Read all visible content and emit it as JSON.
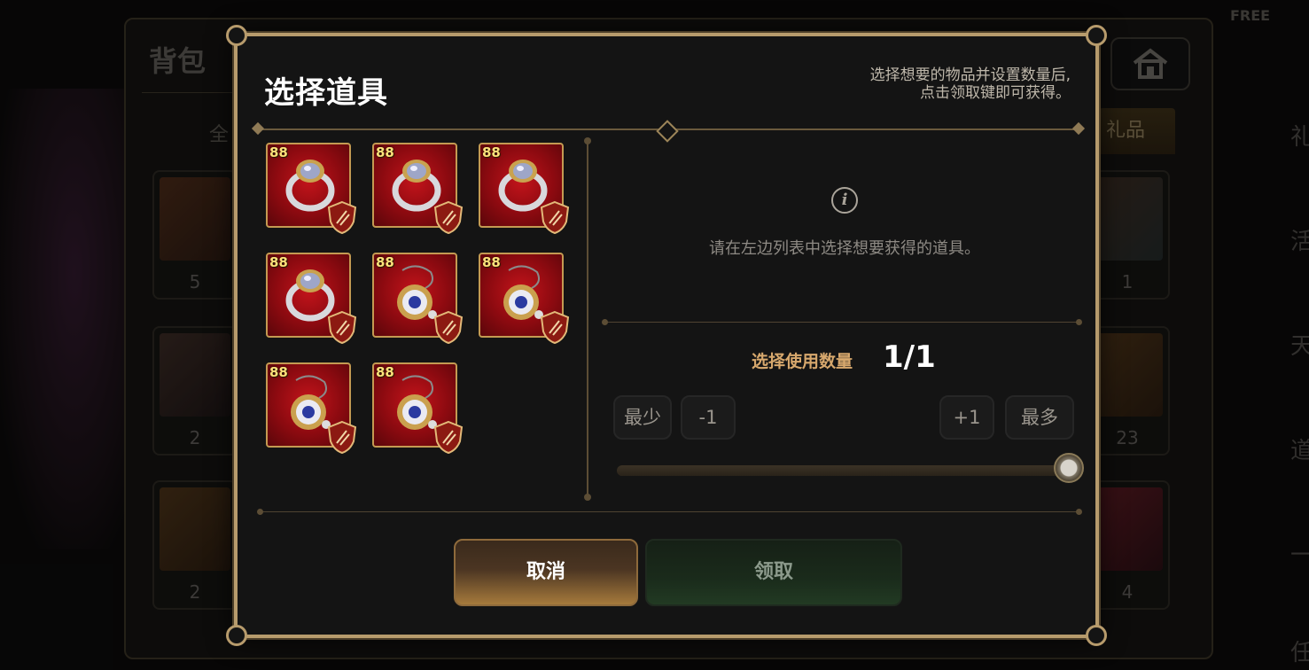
{
  "background": {
    "bag_title": "背包",
    "tab_left": "全",
    "tab_right": "礼品",
    "free_tag": "FREE",
    "side_labels": [
      "礼",
      "活",
      "天",
      "道",
      "一",
      "任"
    ],
    "slot_counts_left": [
      "5",
      "2",
      "2"
    ],
    "slot_counts_right": [
      "1",
      "23",
      "4"
    ]
  },
  "modal": {
    "title": "选择道具",
    "hint_line1": "选择想要的物品并设置数量后,",
    "hint_line2": "点击领取键即可获得。",
    "items": [
      {
        "level": "88",
        "kind": "ring"
      },
      {
        "level": "88",
        "kind": "ring"
      },
      {
        "level": "88",
        "kind": "ring"
      },
      {
        "level": "88",
        "kind": "ring"
      },
      {
        "level": "88",
        "kind": "pocket-watch"
      },
      {
        "level": "88",
        "kind": "pocket-watch"
      },
      {
        "level": "88",
        "kind": "pocket-watch"
      },
      {
        "level": "88",
        "kind": "pocket-watch"
      }
    ],
    "info_icon": "info-icon",
    "info_text": "请在左边列表中选择想要获得的道具。",
    "quantity_label": "选择使用数量",
    "quantity_value": "1/1",
    "quantity_fraction": 1.0,
    "buttons": {
      "min": "最少",
      "minus": "-1",
      "plus": "+1",
      "max": "最多",
      "cancel": "取消",
      "claim": "领取"
    }
  },
  "colors": {
    "frame_gold": "#b79b6c",
    "item_red": "#c3141b",
    "quantity_label": "#d7a86d",
    "cancel_gold": "#a67a3c",
    "claim_green": "#223a23"
  }
}
